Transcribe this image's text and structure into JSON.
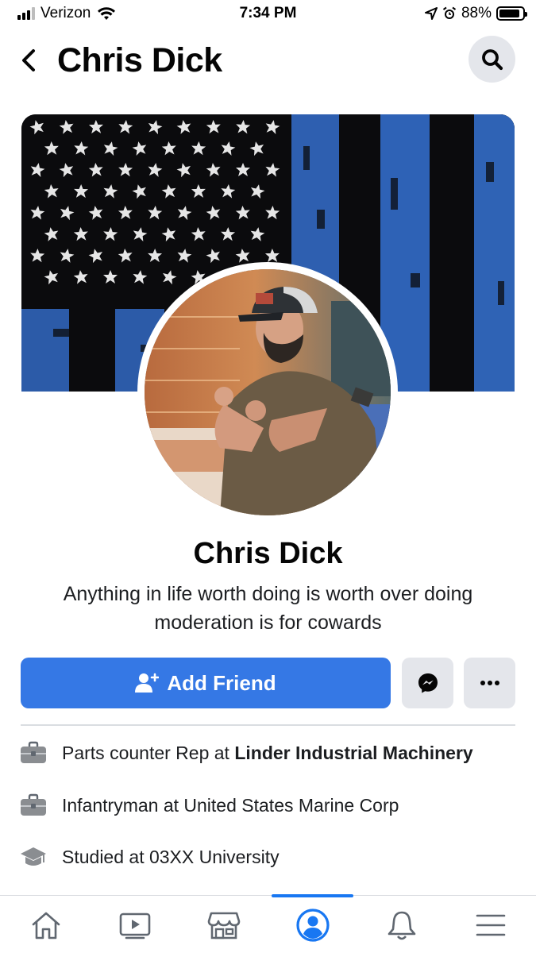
{
  "status_bar": {
    "carrier": "Verizon",
    "time": "7:34 PM",
    "battery_percent": "88%",
    "battery_level": 0.88,
    "icons": [
      "signal-icon",
      "wifi-icon",
      "location-icon",
      "alarm-icon",
      "battery-icon"
    ]
  },
  "header": {
    "title": "Chris Dick",
    "back_icon": "chevron-left-icon",
    "search_icon": "search-icon"
  },
  "profile": {
    "name": "Chris Dick",
    "bio": "Anything in life worth doing is worth over doing moderation is for cowards"
  },
  "actions": {
    "add_friend_label": "Add Friend",
    "add_friend_icon": "add-person-icon",
    "messenger_icon": "messenger-icon",
    "more_icon": "more-icon"
  },
  "details": [
    {
      "icon": "briefcase-icon",
      "prefix": "Parts counter Rep at ",
      "emphasis": "Linder Industrial Machinery"
    },
    {
      "icon": "briefcase-icon",
      "text": "Infantryman at United States Marine Corp"
    },
    {
      "icon": "graduation-cap-icon",
      "text": "Studied at 03XX University"
    }
  ],
  "bottom_nav": {
    "items": [
      "home-icon",
      "video-icon",
      "marketplace-icon",
      "profile-icon",
      "notifications-icon",
      "menu-icon"
    ],
    "active": "profile-icon"
  },
  "colors": {
    "primary_blue": "#3578e5",
    "nav_active_blue": "#1877f2",
    "button_gray": "#e4e6eb",
    "text": "#050505"
  }
}
